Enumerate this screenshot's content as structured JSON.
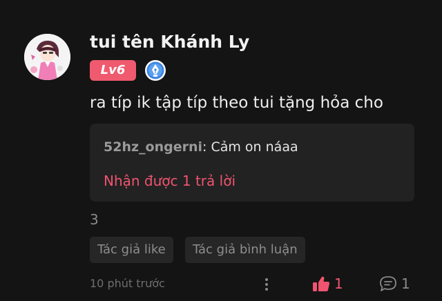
{
  "comment": {
    "username": "tui tên Khánh Ly",
    "level": "Lv6",
    "text": "ra típ ik tập típ theo tui tặng hỏa cho",
    "reply": {
      "author": "52hz_ongerni",
      "separator": ": ",
      "text": "Cảm on náaa",
      "more_replies": "Nhận được 1 trả lời"
    },
    "count": "3",
    "tags": [
      "Tác giả like",
      "Tác giả bình luận"
    ],
    "time": "10 phút trước",
    "likes": "1",
    "replies": "1"
  },
  "colors": {
    "background": "#141414",
    "accent": "#f05470",
    "level_badge": "#ef5a6e",
    "reply_box": "#222222"
  },
  "icons": {
    "avatar": "anime-girl-avatar",
    "badge": "pen-nib-icon",
    "more": "more-vertical-icon",
    "like": "thumbs-up-icon",
    "reply": "chat-bubble-icon"
  }
}
